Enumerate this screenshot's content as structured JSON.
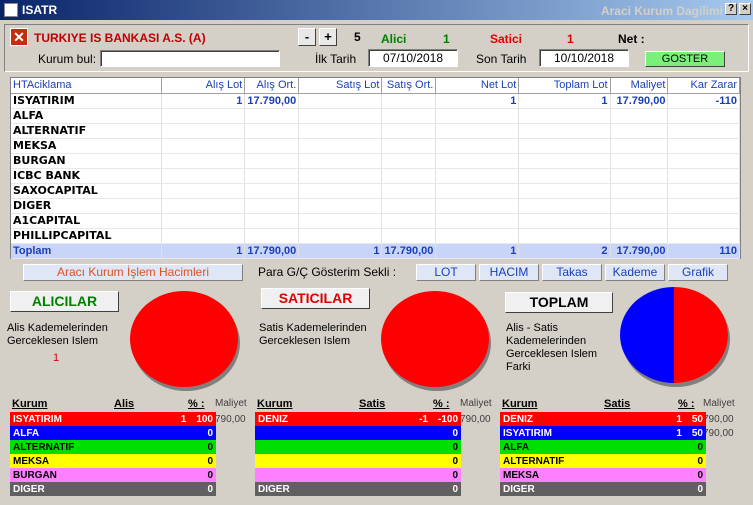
{
  "window": {
    "title": "ISATR",
    "right_title": "Araci Kurum Dagilimi"
  },
  "header": {
    "bank_name": "TURKIYE IS BANKASI A.S. (A)",
    "minus": "-",
    "plus": "+",
    "count": "5",
    "alici_label": "Alici",
    "alici_value": "1",
    "satici_label": "Satici",
    "satici_value": "1",
    "net_label": "Net :",
    "kurum_bul_label": "Kurum bul:",
    "kurum_bul_value": "",
    "ilk_tarih_label": "İlk Tarih",
    "ilk_tarih": "07/10/2018",
    "son_tarih_label": "Son Tarih",
    "son_tarih": "10/10/2018",
    "goster": "GOSTER"
  },
  "grid": {
    "columns": [
      "HTAciklama",
      "Alış Lot",
      "Alış Ort.",
      "Satış Lot",
      "Satış Ort.",
      "Net Lot",
      "Toplam Lot",
      "Maliyet",
      "Kar Zarar"
    ],
    "rows": [
      {
        "name": "ISYATIRIM",
        "alis_lot": "1",
        "alis_ort": "17.790,00",
        "satis_lot": "",
        "satis_ort": "",
        "net_lot": "1",
        "toplam_lot": "1",
        "maliyet": "17.790,00",
        "kar_zarar": "-110"
      },
      {
        "name": "ALFA",
        "alis_lot": "",
        "alis_ort": "",
        "satis_lot": "",
        "satis_ort": "",
        "net_lot": "",
        "toplam_lot": "",
        "maliyet": "",
        "kar_zarar": ""
      },
      {
        "name": "ALTERNATIF",
        "alis_lot": "",
        "alis_ort": "",
        "satis_lot": "",
        "satis_ort": "",
        "net_lot": "",
        "toplam_lot": "",
        "maliyet": "",
        "kar_zarar": ""
      },
      {
        "name": "MEKSA",
        "alis_lot": "",
        "alis_ort": "",
        "satis_lot": "",
        "satis_ort": "",
        "net_lot": "",
        "toplam_lot": "",
        "maliyet": "",
        "kar_zarar": ""
      },
      {
        "name": "BURGAN",
        "alis_lot": "",
        "alis_ort": "",
        "satis_lot": "",
        "satis_ort": "",
        "net_lot": "",
        "toplam_lot": "",
        "maliyet": "",
        "kar_zarar": ""
      },
      {
        "name": "ICBC BANK",
        "alis_lot": "",
        "alis_ort": "",
        "satis_lot": "",
        "satis_ort": "",
        "net_lot": "",
        "toplam_lot": "",
        "maliyet": "",
        "kar_zarar": ""
      },
      {
        "name": "SAXOCAPITAL",
        "alis_lot": "",
        "alis_ort": "",
        "satis_lot": "",
        "satis_ort": "",
        "net_lot": "",
        "toplam_lot": "",
        "maliyet": "",
        "kar_zarar": ""
      },
      {
        "name": "DIGER",
        "alis_lot": "",
        "alis_ort": "",
        "satis_lot": "",
        "satis_ort": "",
        "net_lot": "",
        "toplam_lot": "",
        "maliyet": "",
        "kar_zarar": ""
      },
      {
        "name": "A1CAPITAL",
        "alis_lot": "",
        "alis_ort": "",
        "satis_lot": "",
        "satis_ort": "",
        "net_lot": "",
        "toplam_lot": "",
        "maliyet": "",
        "kar_zarar": ""
      },
      {
        "name": "PHILLIPCAPITAL",
        "alis_lot": "",
        "alis_ort": "",
        "satis_lot": "",
        "satis_ort": "",
        "net_lot": "",
        "toplam_lot": "",
        "maliyet": "",
        "kar_zarar": ""
      }
    ],
    "total": {
      "name": "Toplam",
      "alis_lot": "1",
      "alis_ort": "17.790,00",
      "satis_lot": "1",
      "satis_ort": "17.790,00",
      "net_lot": "1",
      "toplam_lot": "2",
      "maliyet": "17.790,00",
      "kar_zarar": "110"
    }
  },
  "tabs": {
    "hacimler": "Aracı Kurum İşlem Hacimleri",
    "para_label": "Para G/Ç Gösterim Sekli :",
    "lot": "LOT",
    "hacim": "HACIM",
    "takas": "Takas",
    "kademe": "Kademe",
    "grafik": "Grafik"
  },
  "panels": {
    "alicilar": {
      "title": "ALICILAR",
      "desc1": "Alis Kademelerinden",
      "desc2": "Gerceklesen Islem",
      "count": "1"
    },
    "saticilar": {
      "title": "SATICILAR",
      "desc1": "Satis Kademelerinden",
      "desc2": "Gerceklesen Islem"
    },
    "toplam": {
      "title": "TOPLAM",
      "desc1": "Alis - Satis",
      "desc2": "Kademelerinden",
      "desc3": "Gerceklesen Islem",
      "desc4": "Farki"
    }
  },
  "colors": {
    "red": "#ff0000",
    "blue": "#0000ff",
    "green": "#00e000",
    "yellow": "#ffff00",
    "pink": "#ff80ff",
    "gray": "#606060"
  },
  "lists": {
    "alici": {
      "h_kurum": "Kurum",
      "h_val": "Alis",
      "h_pct": "% :",
      "h_mal": "Maliyet",
      "mal_val": "790,00",
      "rows": [
        {
          "name": "ISYATIRIM",
          "val": "1",
          "pct": "100"
        },
        {
          "name": "ALFA",
          "val": "",
          "pct": "0"
        },
        {
          "name": "ALTERNATIF",
          "val": "",
          "pct": "0"
        },
        {
          "name": "MEKSA",
          "val": "",
          "pct": "0"
        },
        {
          "name": "BURGAN",
          "val": "",
          "pct": "0"
        },
        {
          "name": "DIGER",
          "val": "",
          "pct": "0"
        }
      ]
    },
    "satici": {
      "h_kurum": "Kurum",
      "h_val": "Satis",
      "h_pct": "% :",
      "h_mal": "Maliyet",
      "mal_val": "790,00",
      "rows": [
        {
          "name": "DENIZ",
          "val": "-1",
          "pct": "-100"
        },
        {
          "name": "",
          "val": "",
          "pct": "0"
        },
        {
          "name": "",
          "val": "",
          "pct": "0"
        },
        {
          "name": "",
          "val": "",
          "pct": "0"
        },
        {
          "name": "",
          "val": "",
          "pct": "0"
        },
        {
          "name": "DIGER",
          "val": "",
          "pct": "0"
        }
      ]
    },
    "toplam": {
      "h_kurum": "Kurum",
      "h_val": "Satis",
      "h_pct": "% :",
      "h_mal": "Maliyet",
      "mal_val1": "790,00",
      "mal_val2": "790,00",
      "rows": [
        {
          "name": "DENIZ",
          "val": "1",
          "pct": "50"
        },
        {
          "name": "ISYATIRIM",
          "val": "1",
          "pct": "50"
        },
        {
          "name": "ALFA",
          "val": "",
          "pct": "0"
        },
        {
          "name": "ALTERNATIF",
          "val": "",
          "pct": "0"
        },
        {
          "name": "MEKSA",
          "val": "",
          "pct": "0"
        },
        {
          "name": "DIGER",
          "val": "",
          "pct": "0"
        }
      ]
    }
  }
}
